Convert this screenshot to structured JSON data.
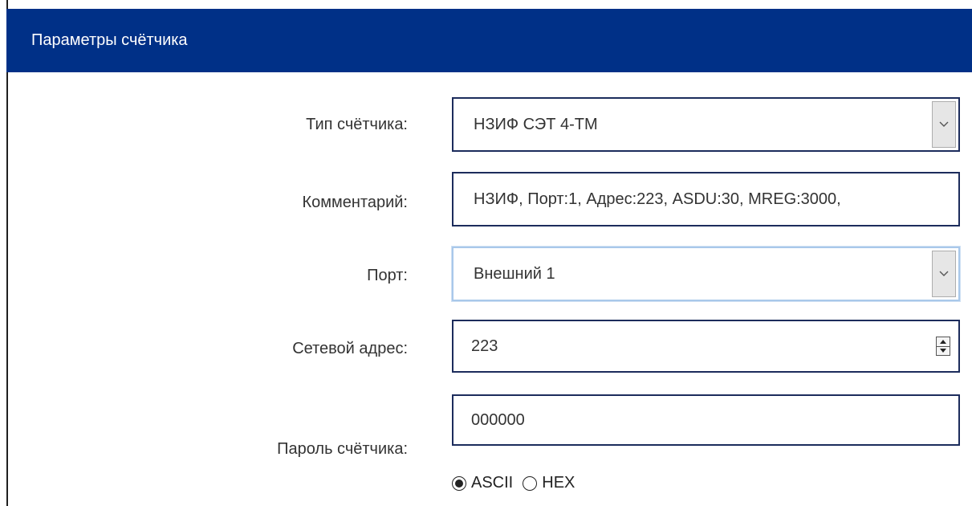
{
  "header": {
    "title": "Параметры счётчика"
  },
  "form": {
    "meter_type": {
      "label": "Тип счётчика:",
      "value": "НЗИФ СЭТ 4-ТМ"
    },
    "comment": {
      "label": "Комментарий:",
      "value": "НЗИФ, Порт:1, Адрес:223, ASDU:30, MREG:3000,"
    },
    "port": {
      "label": "Порт:",
      "value": "Внешний 1"
    },
    "network_address": {
      "label": "Сетевой адрес:",
      "value": "223"
    },
    "password": {
      "label": "Пароль счётчика:",
      "value": "000000",
      "encoding": {
        "options": [
          "ASCII",
          "HEX"
        ],
        "selected": "ASCII"
      }
    }
  },
  "colors": {
    "header_bg": "#003087",
    "field_border": "#1c2c5c",
    "focus_border": "#a9c8ea"
  },
  "icons": {
    "dropdown": "chevron-down-icon",
    "spinner": "spinner-icon"
  }
}
